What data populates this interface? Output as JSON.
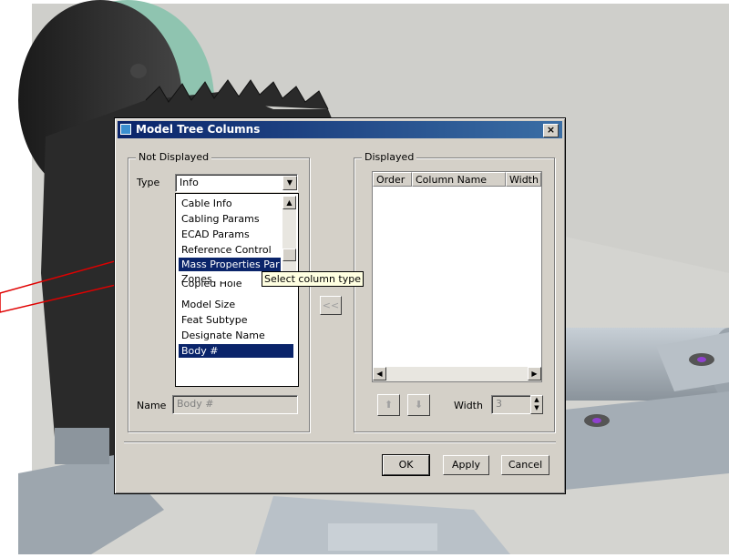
{
  "dialog": {
    "title": "Model Tree Columns",
    "close_label": "×"
  },
  "not_displayed": {
    "label": "Not Displayed",
    "type_label": "Type",
    "type_value": "Info",
    "list_items": [
      "Cable Info",
      "Cabling Params",
      "ECAD Params",
      "Reference Control",
      "Mass Properties Par",
      "Zones",
      "Copied Hole",
      "Model Size",
      "Feat Subtype",
      "Designate Name",
      "Body #"
    ],
    "selected_item": "Body #",
    "name_label": "Name",
    "name_value": "Body #"
  },
  "tooltip": "Select column type",
  "transfer": {
    "remove_label": "<<"
  },
  "displayed": {
    "label": "Displayed",
    "columns": [
      "Order",
      "Column Name",
      "Width"
    ],
    "width_label": "Width",
    "width_value": "3"
  },
  "buttons": {
    "ok": "OK",
    "apply": "Apply",
    "cancel": "Cancel"
  },
  "colors": {
    "title_start": "#0a246a",
    "title_end": "#3a6ea5",
    "selection": "#0a246a",
    "annotation_arrow": "#e00000"
  }
}
